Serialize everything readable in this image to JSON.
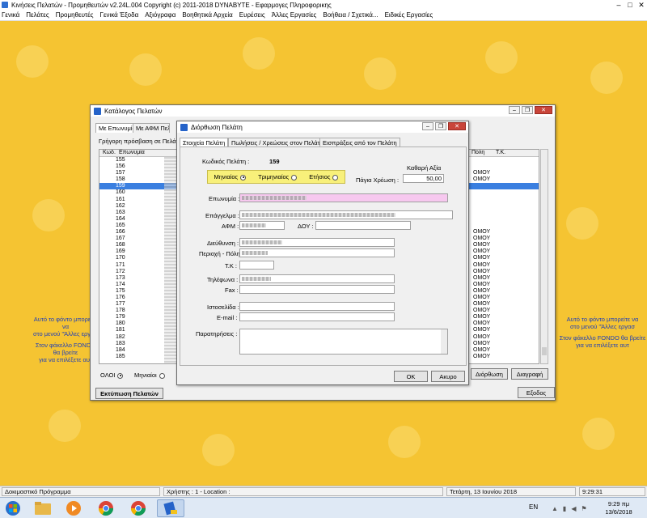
{
  "app": {
    "title": "Κινήσεις Πελατών - Προμηθευτών  v2.24L.004   Copyright (c) 2011-2018  DYNABYTE - Εφαρμογες Πληροφορικης",
    "menu": [
      "Γενικά",
      "Πελάτες",
      "Προμηθευτές",
      "Γενικά Έξοδα",
      "Αξιόγραφα",
      "Βοηθητικά Αρχεία",
      "Ευρέσεις",
      "Άλλες Εργασίες",
      "Βοήθεια / Σχετικά...",
      "Ειδικές Εργασίες"
    ]
  },
  "desktop_text": {
    "left": [
      "Αυτό το φόντο μπορείτε να",
      "στο μενού \"Άλλες εργασ",
      "",
      "Στον φάκελλο FONDO θα βρείτε",
      "για να επιλέξετε αυτ"
    ],
    "right": [
      "Αυτό το φόντο μπορείτε να",
      "στο μενού \"Άλλες εργασ",
      "",
      "Στον φάκελλο FONDO θα βρείτε",
      "για να επιλέξετε αυτ"
    ]
  },
  "catalog": {
    "title": "Κατάλογος Πελατών",
    "tabs": [
      "Με Επωνυμία",
      "Με ΑΦΜ Πελάτ"
    ],
    "quick_access": "Γρήγορη πρόσβαση σε Πελάτ",
    "col_code": "Κωδ.",
    "col_name": "Επωνυμία",
    "col_city": "Πόλη",
    "col_tk": "Τ.Κ.",
    "codes": [
      "155",
      "156",
      "157",
      "158",
      "159",
      "160",
      "161",
      "162",
      "163",
      "164",
      "165",
      "166",
      "167",
      "168",
      "169",
      "170",
      "171",
      "172",
      "173",
      "174",
      "175",
      "176",
      "177",
      "178",
      "179",
      "180",
      "181",
      "182",
      "183",
      "184",
      "185"
    ],
    "selected_code": "159",
    "city_values": [
      "",
      "",
      "ΟΜΟΥ",
      "ΟΜΟΥ",
      "",
      "",
      "",
      "",
      "",
      "",
      "",
      "ΟΜΟΥ",
      "ΟΜΟΥ",
      "ΟΜΟΥ",
      "ΟΜΟΥ",
      "ΟΜΟΥ",
      "ΟΜΟΥ",
      "ΟΜΟΥ",
      "ΟΜΟΥ",
      "ΟΜΟΥ",
      "ΟΜΟΥ",
      "ΟΜΟΥ",
      "ΟΜΟΥ",
      "ΟΜΟΥ",
      "ΟΜΟΥ",
      "ΟΜΟΥ",
      "ΟΜΟΥ",
      "ΟΜΟΥ",
      "ΟΜΟΥ",
      "ΟΜΟΥ",
      "ΟΜΟΥ"
    ],
    "filter_all": "ΟΛΟΙ",
    "filter_monthly": "Μηνιαίοι",
    "print_button": "Εκτύπωση Πελατών",
    "edit_button": "Διόρθωση",
    "delete_button": "Διαγραφή",
    "exit_button": "Εξοδος"
  },
  "editor": {
    "title": "Διόρθωση Πελάτη",
    "tabs": [
      "Στοιχεία Πελάτη",
      "Πωλήσεις / Χρεώσεις στον Πελάτη",
      "Εισπράξεις από τον Πελάτη"
    ],
    "code_label": "Κωδικός Πελάτη :",
    "code_value": "159",
    "net_value_label": "Καθαρή Αξία",
    "fixed_charge_label": "Πάγια Χρέωση :",
    "fixed_charge_value": "50,00",
    "period_monthly": "Μηνιαίος",
    "period_quarterly": "Τριμηνιαίος",
    "period_yearly": "Ετήσιος",
    "name_label": "Επωνυμία :",
    "profession_label": "Επάγγελμα :",
    "afm_label": "ΑΦΜ :",
    "doy_label": "ΔΟΥ :",
    "address_label": "Διεύθυνση :",
    "area_label": "Περιοχή - Πόλη :",
    "tk_label": "Τ.Κ :",
    "phones_label": "Τηλέφωνα :",
    "fax_label": "Fax :",
    "website_label": "Ιστοσελίδα :",
    "email_label": "E-mail :",
    "notes_label": "Παρατηρήσεις :",
    "ok_button": "ΟΚ",
    "cancel_button": "Ακυρο"
  },
  "statusbar": {
    "program": "Δοκιμαστικό Πρόγραμμα",
    "user": "Χρήστης : 1  -  Location :",
    "date": "Τετάρτη, 13 Ιουνίου 2018",
    "time": "9:29:31"
  },
  "taskbar": {
    "lang": "EN",
    "clock_time": "9:29 πμ",
    "clock_date": "13/6/2018"
  },
  "colors": {
    "desktop": "#f5c432",
    "selection": "#3a7fe0",
    "name_field": "#f7c8ef",
    "period_box": "#f8f07a"
  }
}
